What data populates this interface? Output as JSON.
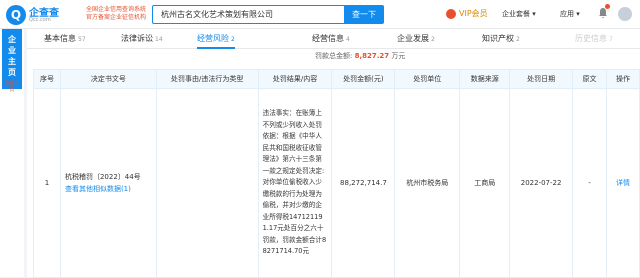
{
  "header": {
    "logo_glyph": "Q",
    "logo_text": "企查查",
    "logo_sub": "Qcc.com",
    "slogan_line1": "全国企业信用查询系统",
    "slogan_line2": "官方备案企业征信机构",
    "search_value": "杭州古名文化艺术策划有限公司",
    "search_button": "查一下",
    "vip_label": "VIP会员",
    "enterprise_label": "企业套餐",
    "app_label": "应用"
  },
  "sidebar": {
    "main_label_1": "企",
    "main_label_2": "业",
    "main_label_3": "主",
    "main_label_4": "页",
    "sub_label": "品牌主页"
  },
  "tabs": [
    {
      "label": "基本信息",
      "count": "57"
    },
    {
      "label": "法律诉讼",
      "count": "14"
    },
    {
      "label": "经营风险",
      "count": "2"
    },
    {
      "label": "经营信息",
      "count": "4"
    },
    {
      "label": "企业发展",
      "count": "2"
    },
    {
      "label": "知识产权",
      "count": "2"
    },
    {
      "label": "历史信息",
      "count": "7"
    }
  ],
  "summary": {
    "label": "罚款总金额:",
    "value": "8,827.27",
    "unit": "万元"
  },
  "table": {
    "headers": [
      "序号",
      "决定书文号",
      "处罚事由/违法行为类型",
      "处罚结果/内容",
      "处罚金额(元)",
      "处罚单位",
      "数据来源",
      "处罚日期",
      "原文",
      "操作"
    ],
    "rows": [
      {
        "index": "1",
        "doc_no": "杭税稽罚〔2022〕44号",
        "doc_link": "查看其他相似数据(1)",
        "reason": "",
        "content": "违法事实：在账簿上不列或少列收入处罚依据：根据《中华人民共和国税收征收管理法》第六十三条第一款之规定处罚决定:对你单位偷税收入少缴税款的行为处理为偷税，并对少缴的企业所得税147121191.17元处百分之六十罚款，罚款金额合计88271714.70元",
        "amount": "88,272,714.7",
        "unit": "杭州市税务局",
        "source": "工商局",
        "date": "2022-07-22",
        "original": "-",
        "action": "详情"
      }
    ]
  }
}
